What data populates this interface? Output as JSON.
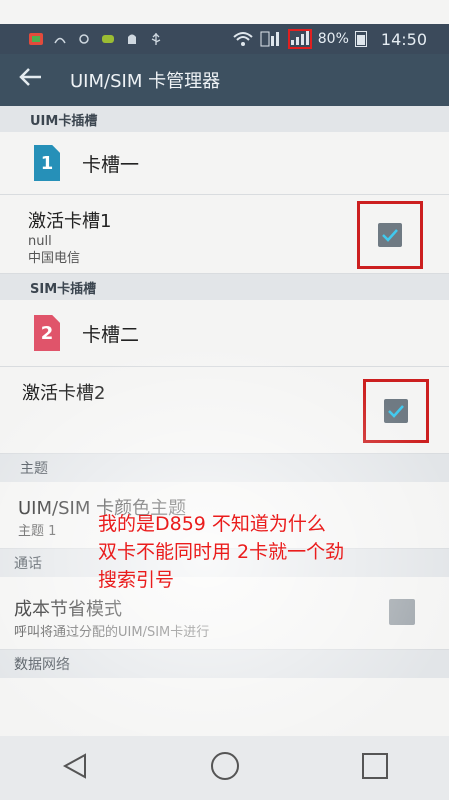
{
  "status_bar": {
    "battery_pct": "80%",
    "time": "14:50",
    "icons": [
      "app-icon",
      "ring-icon",
      "circle-icon",
      "game-icon",
      "android-icon",
      "usb-icon",
      "wifi-icon",
      "data-icon",
      "signal-icon",
      "battery-icon"
    ]
  },
  "action_bar": {
    "title": "UIM/SIM 卡管理器",
    "back_icon": "back-arrow-icon"
  },
  "uim_section": {
    "header": "UIM卡插槽",
    "slot": {
      "number": "1",
      "label": "卡槽一",
      "color": "#2690b8"
    },
    "toggle": {
      "title": "激活卡槽1",
      "sub1": "null",
      "sub2": "中国电信",
      "checked": true
    }
  },
  "sim_section": {
    "header": "SIM卡插槽",
    "slot": {
      "number": "2",
      "label": "卡槽二",
      "color": "#e0546a"
    },
    "toggle": {
      "title": "激活卡槽2",
      "checked": true
    }
  },
  "theme_section": {
    "header": "主题",
    "item": {
      "title": "UIM/SIM 卡颜色主题",
      "sub": "主题 1"
    }
  },
  "call_section": {
    "header": "通话",
    "item": {
      "title": "成本节省模式",
      "sub": "呼叫将通过分配的UIM/SIM卡进行",
      "checked": false
    }
  },
  "data_section": {
    "header": "数据网络"
  },
  "overlay": {
    "line1": "我的是D859 不知道为什么",
    "line2": "双卡不能同时用 2卡就一个劲",
    "line3": "搜索引号",
    "color": "#ea1c1c"
  },
  "nav_bar": {
    "icons": [
      "nav-back-icon",
      "nav-home-icon",
      "nav-recent-icon"
    ]
  }
}
